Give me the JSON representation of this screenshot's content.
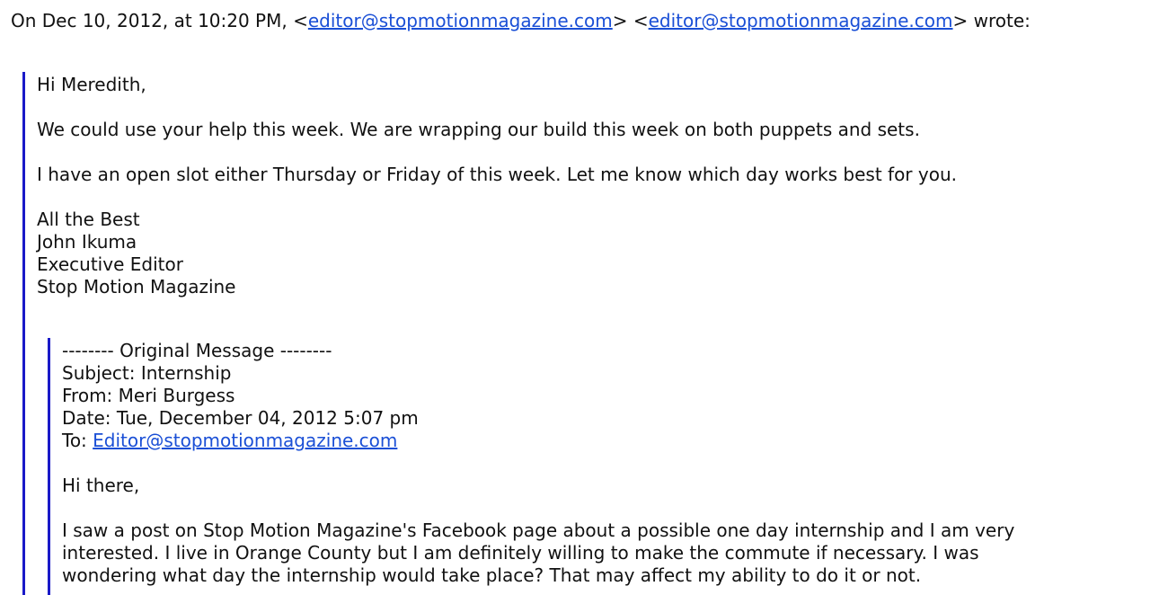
{
  "header": {
    "prefix": "On Dec 10, 2012, at 10:20 PM, <",
    "email1": "editor@stopmotionmagazine.com",
    "middle": "> <",
    "email2": "editor@stopmotionmagazine.com",
    "suffix": "> wrote:"
  },
  "reply": {
    "greeting": "Hi Meredith,",
    "body1": "We could use your help this week. We are wrapping our build this week on both puppets and sets.",
    "body2": "I have an open slot either Thursday or Friday of this week. Let me know which day works best for you.",
    "sign_line1": "All the Best",
    "sign_line2": "John Ikuma",
    "sign_line3": "Executive Editor",
    "sign_line4": "Stop Motion Magazine"
  },
  "original": {
    "separator": "-------- Original Message --------",
    "subject": "Subject: Internship",
    "from": "From: Meri Burgess",
    "date": "Date: Tue, December 04, 2012 5:07 pm",
    "to_label": "To: ",
    "to_email": "Editor@stopmotionmagazine.com",
    "greeting": "Hi there,",
    "body_line1": "I saw a post on Stop Motion Magazine's Facebook page about a possible one day internship and I am very",
    "body_line2": "interested. I live in Orange County but I am definitely willing to make the commute if necessary. I was",
    "body_line3": "wondering what day the internship would take place? That may affect my ability to do it or not."
  }
}
